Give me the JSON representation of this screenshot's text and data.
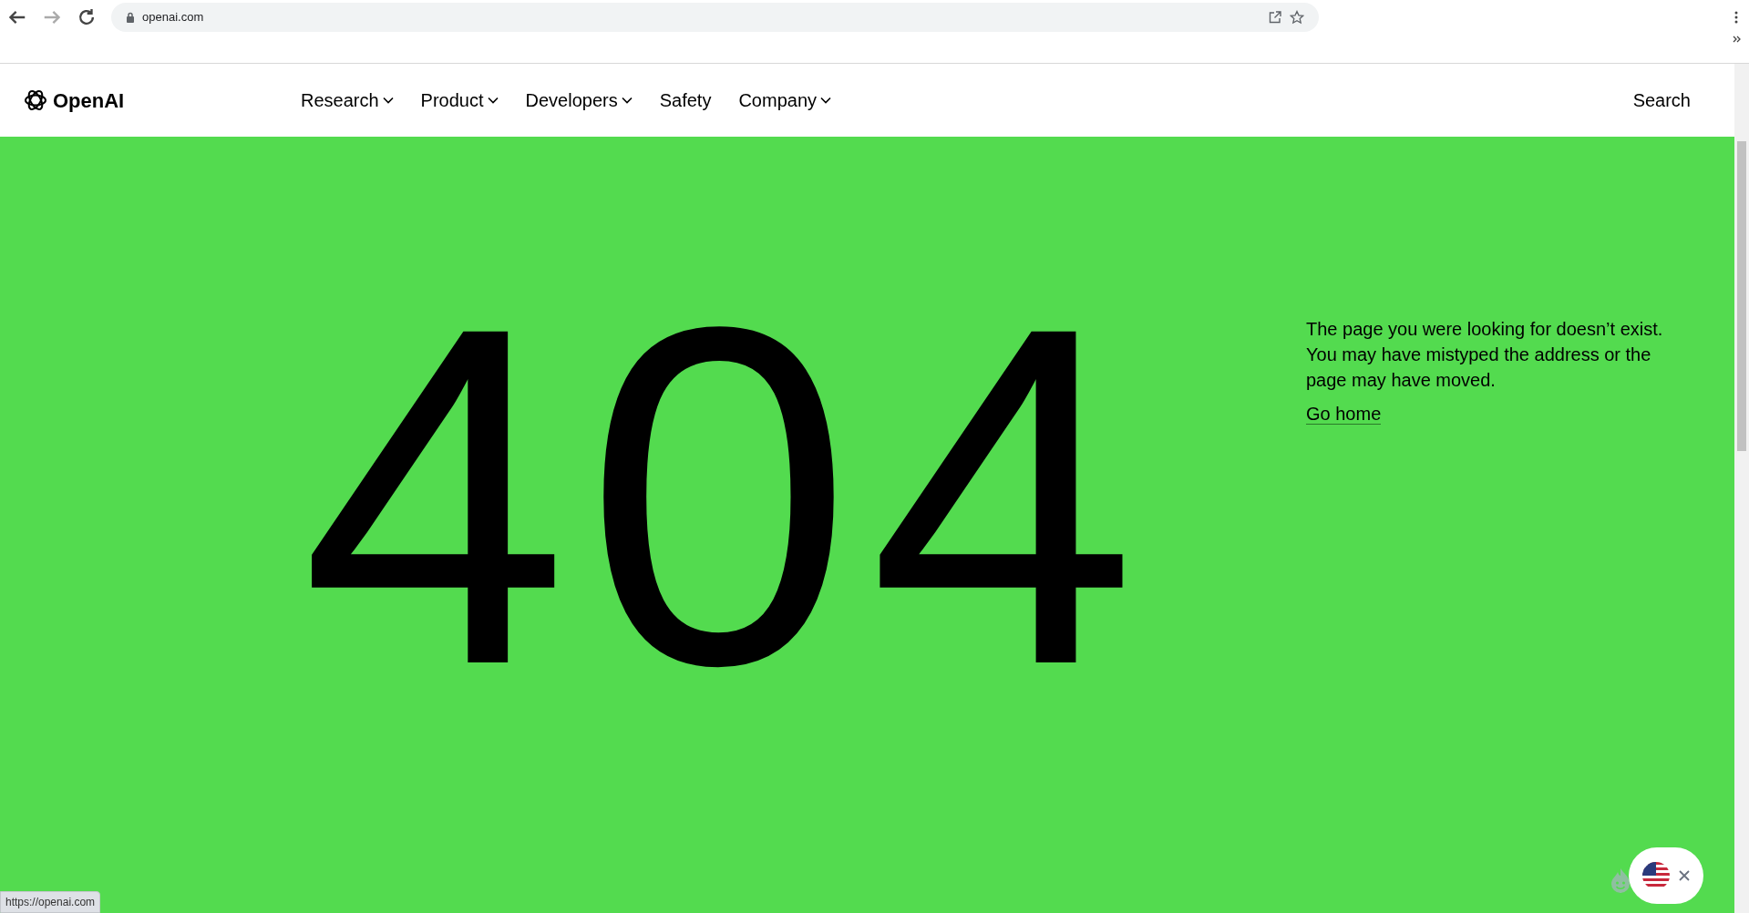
{
  "browser": {
    "address": "openai.com",
    "status_url": "https://openai.com"
  },
  "site_nav": {
    "logo": "OpenAI",
    "items": [
      {
        "label": "Research",
        "dropdown": true
      },
      {
        "label": "Product",
        "dropdown": true
      },
      {
        "label": "Developers",
        "dropdown": true
      },
      {
        "label": "Safety",
        "dropdown": false
      },
      {
        "label": "Company",
        "dropdown": true
      }
    ],
    "search": "Search"
  },
  "error": {
    "code": "404",
    "message": "The page you were looking for doesn’t exist. You may have mistyped the address or the page may have moved.",
    "link": "Go home"
  }
}
